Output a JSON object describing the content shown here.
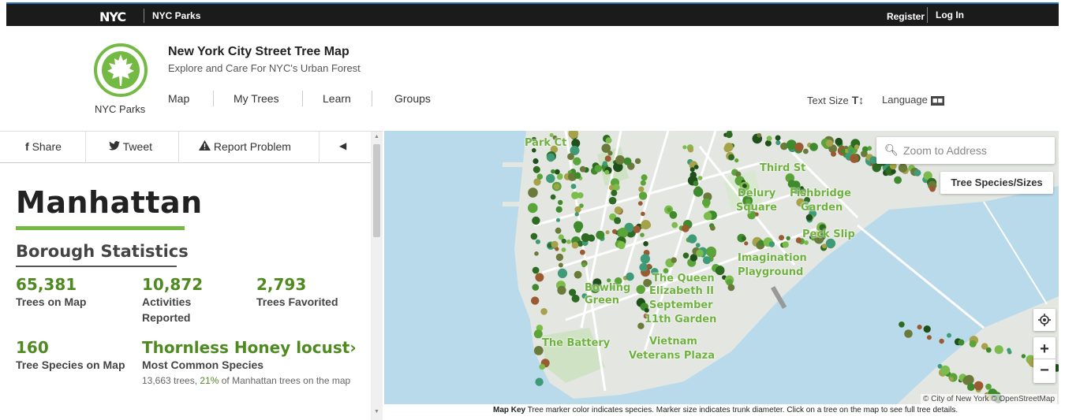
{
  "topbar": {
    "nyc": "NYC",
    "parks": "NYC Parks",
    "register": "Register",
    "login": "Log In"
  },
  "header": {
    "logo_label": "NYC Parks",
    "title": "New York City Street Tree Map",
    "subtitle": "Explore and Care For NYC's Urban Forest",
    "nav": [
      "Map",
      "My Trees",
      "Learn",
      "Groups"
    ],
    "text_size": "Text Size",
    "text_size_glyph": "T↕",
    "language": "Language",
    "language_glyph": "■■"
  },
  "toolbar": {
    "share": "Share",
    "tweet": "Tweet",
    "report": "Report Problem",
    "collapse": "◀"
  },
  "borough": {
    "name": "Manhattan",
    "section_title": "Borough Statistics",
    "stats": [
      {
        "num": "65,381",
        "label": "Trees on Map"
      },
      {
        "num": "10,872",
        "label": "Activities Reported"
      },
      {
        "num": "2,793",
        "label": "Trees Favorited"
      },
      {
        "num": "160",
        "label": "Tree Species on Map"
      }
    ],
    "common": {
      "name": "Thornless Honey locust",
      "arrow": "›",
      "label": "Most Common Species",
      "note_trees": "13,663 trees, ",
      "note_pct": "21%",
      "note_rest": " of Manhattan trees on the map"
    }
  },
  "map": {
    "search_placeholder": "Zoom to Address",
    "species_button": "Tree Species/Sizes",
    "zoom_in": "+",
    "zoom_out": "−",
    "attribution": "© City of New York © OpenStreetMap",
    "labels": {
      "park_ct": "Park Ct",
      "bowling": "Bowling",
      "green": "Green",
      "the_battery": "The Battery",
      "the_queen": "The Queen",
      "elizabeth": "Elizabeth II",
      "september": "September",
      "eleventh": "11th Garden",
      "vietnam": "Vietnam",
      "veterans": "Veterans Plaza",
      "imagination": "Imagination",
      "playground": "Playground",
      "peck_slip": "Peck Slip",
      "delury": "Delury",
      "square": "Square",
      "fishbridge": "Fishbridge",
      "garden": "Garden",
      "third_st": "Third St"
    }
  },
  "mapkey": {
    "title": "Map Key",
    "text": " Tree marker color indicates species. Marker size indicates trunk diameter. Click on a tree on the map to see full tree details."
  },
  "colors": {
    "accent_green": "#74b943",
    "dark_green": "#4e8a1f",
    "water": "#b9daeb",
    "topbar": "#1b1b1b"
  }
}
